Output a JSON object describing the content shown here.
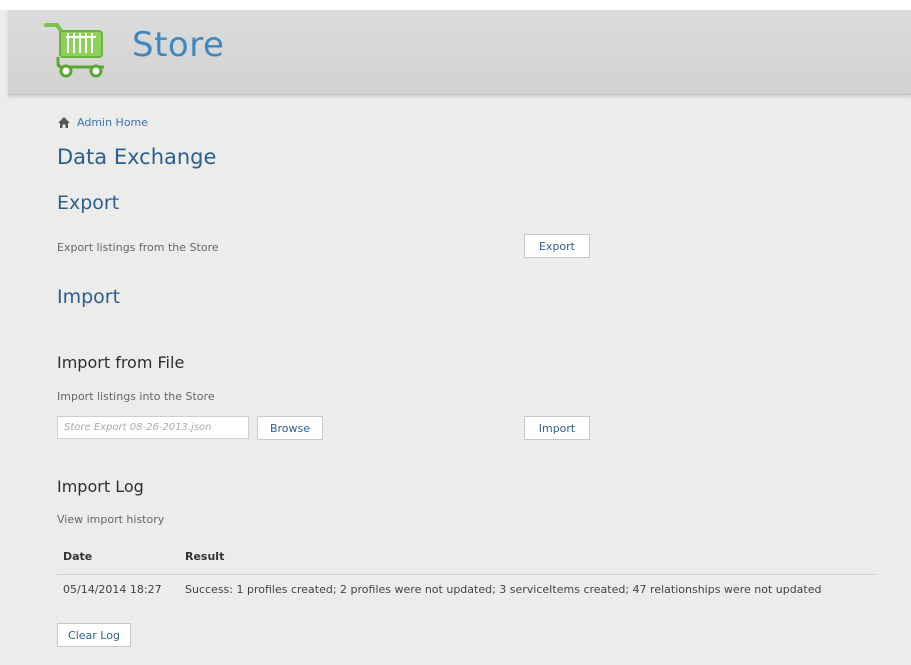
{
  "app": {
    "brand": "Store",
    "logo_icon": "shopping-cart-icon",
    "brand_color": "#3f87bf"
  },
  "breadcrumb": {
    "icon": "home-icon",
    "label": "Admin Home"
  },
  "page": {
    "title": "Data Exchange"
  },
  "export": {
    "heading": "Export",
    "description": "Export listings from the Store",
    "button_label": "Export"
  },
  "import": {
    "heading": "Import",
    "from_file": {
      "heading": "Import from File",
      "description": "Import listings into the Store",
      "file_placeholder": "Store Export 08-26-2013.json",
      "browse_label": "Browse",
      "import_label": "Import"
    },
    "log": {
      "heading": "Import Log",
      "description": "View import history",
      "columns": [
        "Date",
        "Result"
      ],
      "rows": [
        {
          "date": "05/14/2014 18:27",
          "result": "Success: 1 profiles created; 2 profiles were not updated; 3 serviceItems created; 47 relationships were not updated"
        }
      ],
      "clear_label": "Clear Log"
    }
  }
}
